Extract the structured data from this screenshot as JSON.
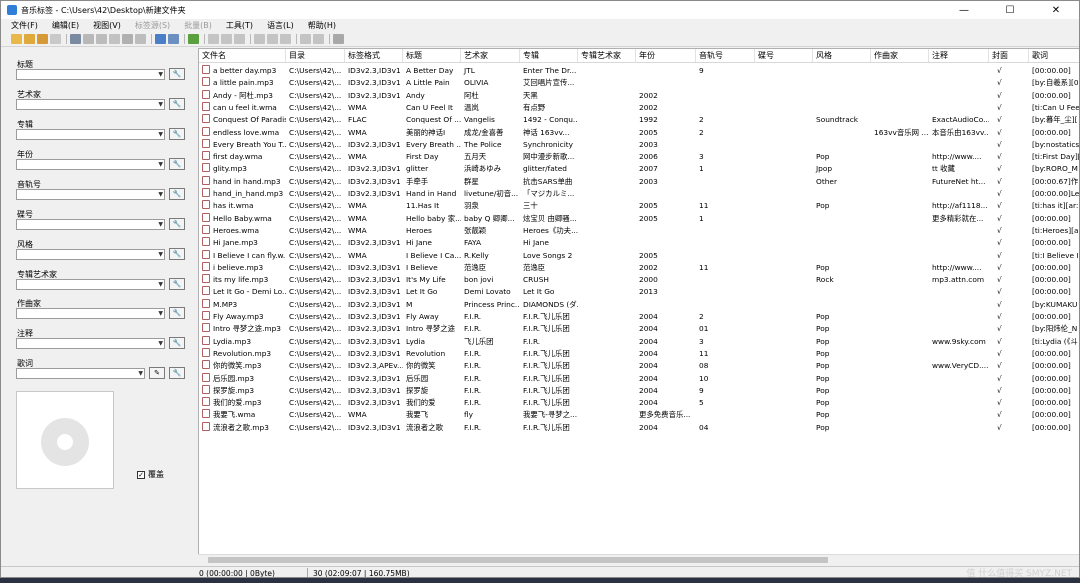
{
  "window": {
    "title": "音乐标签 - C:\\Users\\42\\Desktop\\新建文件夹",
    "minimize": "—",
    "maximize": "☐",
    "close": "✕"
  },
  "menu": [
    {
      "label": "文件(F)",
      "enabled": true
    },
    {
      "label": "编辑(E)",
      "enabled": true
    },
    {
      "label": "视图(V)",
      "enabled": true
    },
    {
      "label": "标签源(S)",
      "enabled": false
    },
    {
      "label": "批量(B)",
      "enabled": false
    },
    {
      "label": "工具(T)",
      "enabled": true
    },
    {
      "label": "语言(L)",
      "enabled": true
    },
    {
      "label": "帮助(H)",
      "enabled": true
    }
  ],
  "fields": [
    {
      "label": "标题"
    },
    {
      "label": "艺术家"
    },
    {
      "label": "专辑"
    },
    {
      "label": "年份"
    },
    {
      "label": "音轨号"
    },
    {
      "label": "碟号"
    },
    {
      "label": "风格"
    },
    {
      "label": "专辑艺术家"
    },
    {
      "label": "作曲家"
    },
    {
      "label": "注释"
    },
    {
      "label": "歌词"
    }
  ],
  "tool_button": "🔧",
  "edit_button": "✎",
  "overwrite_label": "覆盖",
  "overwrite_check": "✓",
  "columns": [
    "文件名",
    "目录",
    "标签格式",
    "标题",
    "艺术家",
    "专辑",
    "专辑艺术家",
    "年份",
    "音轨号",
    "碟号",
    "风格",
    "作曲家",
    "注释",
    "封面",
    "歌词"
  ],
  "rows": [
    [
      "a better day.mp3",
      "C:\\Users\\42\\...",
      "ID3v2.3,ID3v1",
      "A Better Day",
      "JTL",
      "Enter The Dr...",
      "",
      "",
      "9",
      "",
      "",
      "",
      "",
      "√",
      "[00:00.00]"
    ],
    [
      "a little pain.mp3",
      "C:\\Users\\42\\...",
      "ID3v2.3,ID3v1",
      "A Little Pain",
      "OLIVIA",
      "艾回唱片宣传...",
      "",
      "",
      "",
      "",
      "",
      "",
      "",
      "√",
      "[by:自羲系][0"
    ],
    [
      "Andy - 阿杜.mp3",
      "C:\\Users\\42\\...",
      "ID3v2.3,ID3v1",
      "Andy",
      "阿杜",
      "天黑",
      "",
      "2002",
      "",
      "",
      "",
      "",
      "",
      "√",
      "[00:00.00]"
    ],
    [
      "can u feel it.wma",
      "C:\\Users\\42\\...",
      "WMA",
      "Can U Feel It",
      "温岚",
      "有点野",
      "",
      "2002",
      "",
      "",
      "",
      "",
      "",
      "√",
      "[ti:Can U Fee"
    ],
    [
      "Conquest Of Paradis...",
      "C:\\Users\\42\\...",
      "FLAC",
      "Conquest Of ...",
      "Vangelis",
      "1492 - Conqu...",
      "",
      "1992",
      "2",
      "",
      "Soundtrack",
      "",
      "ExactAudioCo...",
      "√",
      "[by:暮年_尘]["
    ],
    [
      "endless love.wma",
      "C:\\Users\\42\\...",
      "WMA",
      "美丽的神话I",
      "成龙/金喜善",
      "神话  163vv...",
      "",
      "2005",
      "2",
      "",
      "",
      "163vv音乐网 ...",
      "本音乐由163vv...",
      "√",
      "[00:00.00]"
    ],
    [
      "Every Breath You T...",
      "C:\\Users\\42\\...",
      "ID3v2.3,ID3v1",
      "Every Breath ...",
      "The Police",
      "Synchronicity",
      "",
      "2003",
      "",
      "",
      "",
      "",
      "",
      "√",
      "[by:nostatics"
    ],
    [
      "first day.wma",
      "C:\\Users\\42\\...",
      "WMA",
      "First Day",
      "五月天",
      "网中漫步新歌...",
      "",
      "2006",
      "3",
      "",
      "Pop",
      "",
      "http://www....",
      "√",
      "[ti:First Day]["
    ],
    [
      "glity.mp3",
      "C:\\Users\\42\\...",
      "ID3v2.3,ID3v1",
      "glitter",
      "浜崎あゆみ",
      "glitter/fated",
      "",
      "2007",
      "1",
      "",
      "Jpop",
      "",
      "tt 收藏",
      "√",
      "[by:RORO_M"
    ],
    [
      "hand in hand.mp3",
      "C:\\Users\\42\\...",
      "ID3v2.3,ID3v1",
      "手牵手",
      "群星",
      "抗击SARS单曲",
      "",
      "2003",
      "",
      "",
      "Other",
      "",
      "FutureNet ht...",
      "√",
      "[00:00.67]作"
    ],
    [
      "hand_in_hand.mp3",
      "C:\\Users\\42\\...",
      "ID3v2.3,ID3v1",
      "Hand in Hand",
      "livetune/初音...",
      "「マジカルミ...",
      "",
      "",
      "",
      "",
      "",
      "",
      "",
      "√",
      "[00:00.00]Le"
    ],
    [
      "has it.wma",
      "C:\\Users\\42\\...",
      "WMA",
      "11.Has It",
      "羽泉",
      "三十",
      "",
      "2005",
      "11",
      "",
      "Pop",
      "",
      "http://af1118...",
      "√",
      "[ti:has it][ar:"
    ],
    [
      "Hello Baby.wma",
      "C:\\Users\\42\\...",
      "WMA",
      "Hello baby 家...",
      "baby Q 卿卿...",
      "炫宝贝 由卿骚...",
      "",
      "2005",
      "1",
      "",
      "",
      "",
      "更多精彩就在...",
      "√",
      "[00:00.00]"
    ],
    [
      "Heroes.wma",
      "C:\\Users\\42\\...",
      "WMA",
      "Heroes",
      "张靓颖",
      "Heroes《功夫...",
      "",
      "",
      "",
      "",
      "",
      "",
      "",
      "√",
      "[ti:Heroes][ar"
    ],
    [
      "Hi Jane.mp3",
      "C:\\Users\\42\\...",
      "ID3v2.3,ID3v1",
      "Hi Jane",
      "FAYA",
      "Hi Jane",
      "",
      "",
      "",
      "",
      "",
      "",
      "",
      "√",
      "[00:00.00]"
    ],
    [
      "I Believe I can fly.w...",
      "C:\\Users\\42\\...",
      "WMA",
      "I Believe I Ca...",
      "R.Kelly",
      "Love Songs 2",
      "",
      "2005",
      "",
      "",
      "",
      "",
      "",
      "√",
      "[ti:I Believe I"
    ],
    [
      "i believe.mp3",
      "C:\\Users\\42\\...",
      "ID3v2.3,ID3v1",
      "I Believe",
      "范逸臣",
      "范逸臣",
      "",
      "2002",
      "11",
      "",
      "Pop",
      "",
      "http://www....",
      "√",
      "[00:00.00]"
    ],
    [
      "its my life.mp3",
      "C:\\Users\\42\\...",
      "ID3v2.3,ID3v1",
      "It's My Life",
      "bon jovi",
      "CRUSH",
      "",
      "2000",
      "",
      "",
      "Rock",
      "",
      "mp3.attn.com",
      "√",
      "[00:00.00]"
    ],
    [
      "Let It Go - Demi Lo...",
      "C:\\Users\\42\\...",
      "ID3v2.3,ID3v1",
      "Let It Go",
      "Demi Lovato",
      "Let It Go",
      "",
      "2013",
      "",
      "",
      "",
      "",
      "",
      "√",
      "[00:00.00]"
    ],
    [
      "M.MP3",
      "C:\\Users\\42\\...",
      "ID3v2.3,ID3v1",
      "M",
      "Princess Princ...",
      "DIAMONDS (ダ...",
      "",
      "",
      "",
      "",
      "",
      "",
      "",
      "√",
      "[by:KUMAKU"
    ],
    [
      "Fly Away.mp3",
      "C:\\Users\\42\\...",
      "ID3v2.3,ID3v1",
      "Fly Away",
      "F.I.R.",
      "F.I.R.飞儿乐团",
      "",
      "2004",
      "2",
      "",
      "Pop",
      "",
      "",
      "√",
      "[00:00.00]"
    ],
    [
      "Intro 寻梦之途.mp3",
      "C:\\Users\\42\\...",
      "ID3v2.3,ID3v1",
      "Intro 寻梦之途",
      "F.I.R.",
      "F.I.R.飞儿乐团",
      "",
      "2004",
      "01",
      "",
      "Pop",
      "",
      "",
      "√",
      "[by:阳炜伦_N"
    ],
    [
      "Lydia.mp3",
      "C:\\Users\\42\\...",
      "ID3v2.3,ID3v1",
      "Lydia",
      "飞儿乐团",
      "F.I.R.",
      "",
      "2004",
      "3",
      "",
      "Pop",
      "",
      "www.9sky.com",
      "√",
      "[ti:Lydia (《斗"
    ],
    [
      "Revolution.mp3",
      "C:\\Users\\42\\...",
      "ID3v2.3,ID3v1",
      "Revolution",
      "F.I.R.",
      "F.I.R.飞儿乐团",
      "",
      "2004",
      "11",
      "",
      "Pop",
      "",
      "",
      "√",
      "[00:00.00]"
    ],
    [
      "你的微笑.mp3",
      "C:\\Users\\42\\...",
      "ID3v2.3,APEv...",
      "你的微笑",
      "F.I.R.",
      "F.I.R.飞儿乐团",
      "",
      "2004",
      "08",
      "",
      "Pop",
      "",
      "www.VeryCD....",
      "√",
      "[00:00.00]"
    ],
    [
      "后乐园.mp3",
      "C:\\Users\\42\\...",
      "ID3v2.3,ID3v1",
      "后乐园",
      "F.I.R.",
      "F.I.R.飞儿乐团",
      "",
      "2004",
      "10",
      "",
      "Pop",
      "",
      "",
      "√",
      "[00:00.00]"
    ],
    [
      "探罗旋.mp3",
      "C:\\Users\\42\\...",
      "ID3v2.3,ID3v1",
      "探罗旋",
      "F.I.R.",
      "F.I.R.飞儿乐团",
      "",
      "2004",
      "9",
      "",
      "Pop",
      "",
      "",
      "√",
      "[00:00.00]"
    ],
    [
      "我们的爱.mp3",
      "C:\\Users\\42\\...",
      "ID3v2.3,ID3v1",
      "我们的爱",
      "F.I.R.",
      "F.I.R.飞儿乐团",
      "",
      "2004",
      "5",
      "",
      "Pop",
      "",
      "",
      "√",
      "[00:00.00]"
    ],
    [
      "我要飞.wma",
      "C:\\Users\\42\\...",
      "WMA",
      "我要飞",
      "fly",
      "我要飞-寻梦之...",
      "",
      "更多免费音乐...",
      "",
      "",
      "Pop",
      "",
      "",
      "√",
      "[00:00.00]"
    ],
    [
      "流浪者之歌.mp3",
      "C:\\Users\\42\\...",
      "ID3v2.3,ID3v1",
      "流浪者之歌",
      "F.I.R.",
      "F.I.R.飞儿乐团",
      "",
      "2004",
      "04",
      "",
      "Pop",
      "",
      "",
      "√",
      "[00:00.00]"
    ]
  ],
  "status": {
    "selected": "0 (00:00:00 | 0Byte)",
    "total": "30 (02:09:07 | 160.75MB)"
  },
  "watermark": "值 什么值得买 SMYZ.NET"
}
